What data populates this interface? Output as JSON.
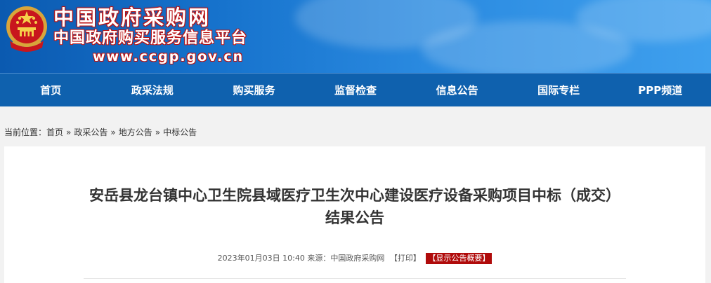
{
  "header": {
    "site_title": "中国政府采购网",
    "site_subtitle": "中国政府购买服务信息平台",
    "site_url": "www.ccgp.gov.cn"
  },
  "nav": {
    "items": [
      {
        "label": "首页"
      },
      {
        "label": "政采法规"
      },
      {
        "label": "购买服务"
      },
      {
        "label": "监督检查"
      },
      {
        "label": "信息公告"
      },
      {
        "label": "国际专栏"
      },
      {
        "label": "PPP频道"
      }
    ]
  },
  "breadcrumb": {
    "prefix": "当前位置：",
    "items": [
      "首页",
      "政采公告",
      "地方公告",
      "中标公告"
    ],
    "separator": "»"
  },
  "article": {
    "title_line1": "安岳县龙台镇中心卫生院县域医疗卫生次中心建设医疗设备采购项目中标（成交）",
    "title_line2": "结果公告",
    "datetime": "2023年01月03日 10:40",
    "source_label": "来源：",
    "source": "中国政府采购网",
    "print_label": "【打印】",
    "summary_label": "【显示公告概要】"
  },
  "colors": {
    "nav_bg": "#0f61ae",
    "banner": "#1672cc",
    "summary_bg": "#b00b0b"
  }
}
